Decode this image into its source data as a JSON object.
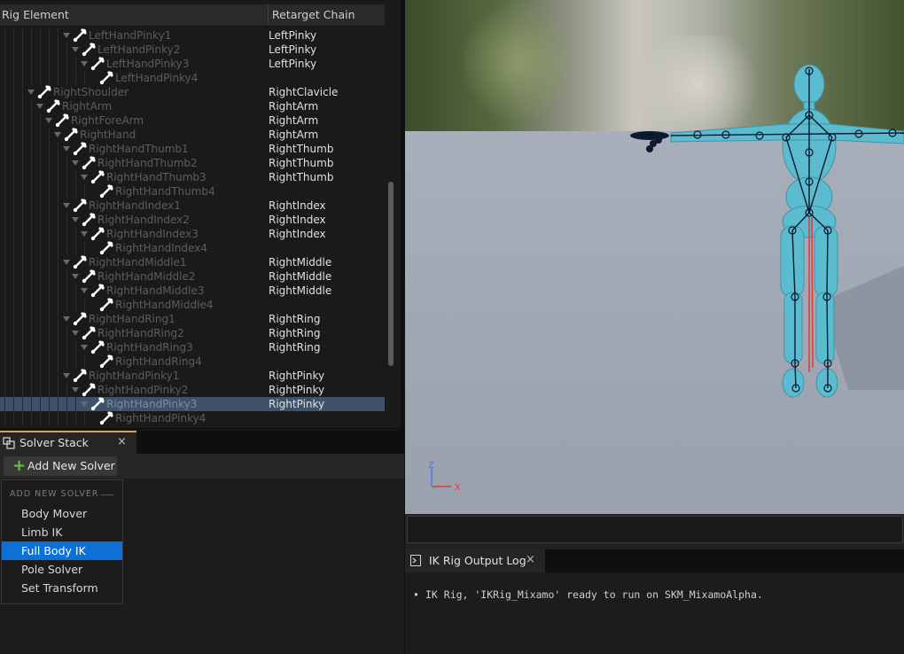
{
  "hierarchy": {
    "col_rig_element": "Rig Element",
    "col_retarget_chain": "Retarget Chain",
    "rows": [
      {
        "name": "LeftHandPinky1",
        "chain": "LeftPinky",
        "depth": 7
      },
      {
        "name": "LeftHandPinky2",
        "chain": "LeftPinky",
        "depth": 8
      },
      {
        "name": "LeftHandPinky3",
        "chain": "LeftPinky",
        "depth": 9
      },
      {
        "name": "LeftHandPinky4",
        "chain": "",
        "depth": 10
      },
      {
        "name": "RightShoulder",
        "chain": "RightClavicle",
        "depth": 3
      },
      {
        "name": "RightArm",
        "chain": "RightArm",
        "depth": 4
      },
      {
        "name": "RightForeArm",
        "chain": "RightArm",
        "depth": 5
      },
      {
        "name": "RightHand",
        "chain": "RightArm",
        "depth": 6
      },
      {
        "name": "RightHandThumb1",
        "chain": "RightThumb",
        "depth": 7
      },
      {
        "name": "RightHandThumb2",
        "chain": "RightThumb",
        "depth": 8
      },
      {
        "name": "RightHandThumb3",
        "chain": "RightThumb",
        "depth": 9
      },
      {
        "name": "RightHandThumb4",
        "chain": "",
        "depth": 10
      },
      {
        "name": "RightHandIndex1",
        "chain": "RightIndex",
        "depth": 7
      },
      {
        "name": "RightHandIndex2",
        "chain": "RightIndex",
        "depth": 8
      },
      {
        "name": "RightHandIndex3",
        "chain": "RightIndex",
        "depth": 9
      },
      {
        "name": "RightHandIndex4",
        "chain": "",
        "depth": 10
      },
      {
        "name": "RightHandMiddle1",
        "chain": "RightMiddle",
        "depth": 7
      },
      {
        "name": "RightHandMiddle2",
        "chain": "RightMiddle",
        "depth": 8
      },
      {
        "name": "RightHandMiddle3",
        "chain": "RightMiddle",
        "depth": 9
      },
      {
        "name": "RightHandMiddle4",
        "chain": "",
        "depth": 10
      },
      {
        "name": "RightHandRing1",
        "chain": "RightRing",
        "depth": 7
      },
      {
        "name": "RightHandRing2",
        "chain": "RightRing",
        "depth": 8
      },
      {
        "name": "RightHandRing3",
        "chain": "RightRing",
        "depth": 9
      },
      {
        "name": "RightHandRing4",
        "chain": "",
        "depth": 10
      },
      {
        "name": "RightHandPinky1",
        "chain": "RightPinky",
        "depth": 7
      },
      {
        "name": "RightHandPinky2",
        "chain": "RightPinky",
        "depth": 8
      },
      {
        "name": "RightHandPinky3",
        "chain": "RightPinky",
        "depth": 9,
        "selected": true
      },
      {
        "name": "RightHandPinky4",
        "chain": "",
        "depth": 10
      }
    ]
  },
  "solver_stack": {
    "tab_title": "Solver Stack",
    "close_glyph": "×",
    "add_button_label": "Add New Solver",
    "add_button_icon": "plus-icon",
    "menu": {
      "heading": "ADD NEW SOLVER",
      "items": [
        "Body Mover",
        "Limb IK",
        "Full Body IK",
        "Pole Solver",
        "Set Transform"
      ],
      "highlighted": "Full Body IK"
    }
  },
  "viewport": {
    "axis_labels": {
      "z": "Z",
      "x": "X"
    },
    "colors": {
      "skin": "#5bbcd0",
      "bone": "#0e1830",
      "axis_x": "#e03a3a",
      "axis_y": "#50c050",
      "axis_z": "#3f7bf0",
      "selection": "#0d70d6"
    }
  },
  "output_log": {
    "tab_title": "IK Rig Output Log",
    "close_glyph": "×",
    "message": "IK Rig, 'IKRig_Mixamo' ready to run on SKM_MixamoAlpha."
  }
}
